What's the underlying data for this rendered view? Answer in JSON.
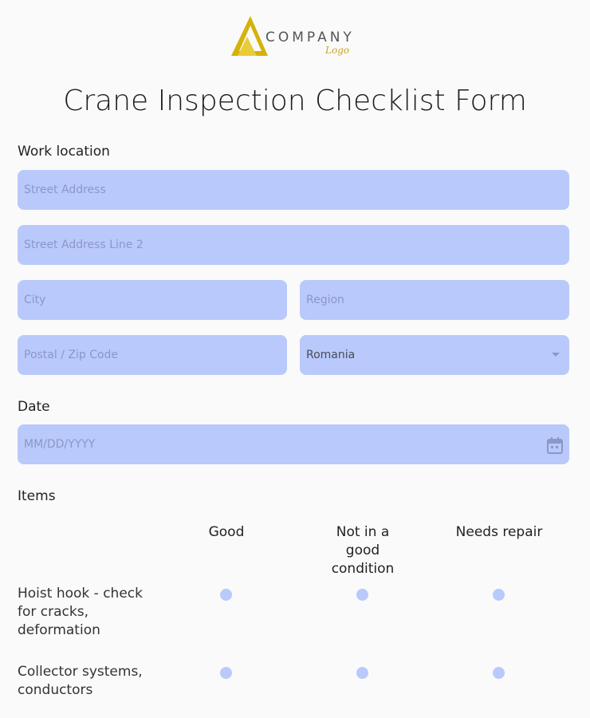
{
  "logo": {
    "word": "COMPANY",
    "sub": "Logo"
  },
  "form": {
    "title": "Crane Inspection Checklist Form"
  },
  "work_location": {
    "label": "Work location",
    "street_placeholder": "Street Address",
    "street2_placeholder": "Street Address Line 2",
    "city_placeholder": "City",
    "region_placeholder": "Region",
    "zip_placeholder": "Postal / Zip Code",
    "country_value": "Romania"
  },
  "date": {
    "label": "Date",
    "placeholder": "MM/DD/YYYY"
  },
  "items": {
    "label": "Items",
    "columns": [
      "Good",
      "Not in a good condition",
      "Needs repair"
    ],
    "rows": [
      {
        "label": "Hoist hook - check for cracks, deformation"
      },
      {
        "label": "Collector systems, conductors"
      }
    ]
  },
  "colors": {
    "field_bg": "#b9c9fb",
    "radio": "#b9c9fb",
    "logo_gold": "#d4b20a",
    "page_bg": "#fafafa"
  }
}
